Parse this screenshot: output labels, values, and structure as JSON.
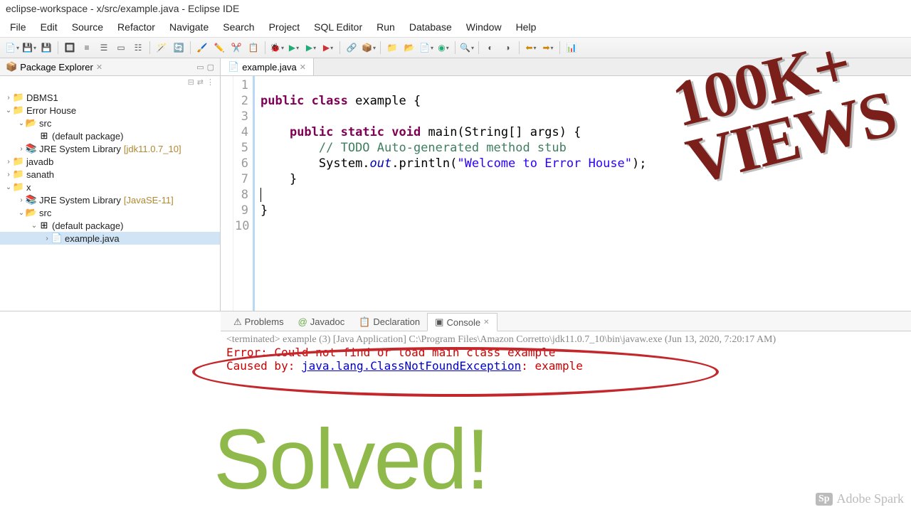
{
  "title": "eclipse-workspace - x/src/example.java - Eclipse IDE",
  "menu": [
    "File",
    "Edit",
    "Source",
    "Refactor",
    "Navigate",
    "Search",
    "Project",
    "SQL Editor",
    "Run",
    "Database",
    "Window",
    "Help"
  ],
  "sidebar": {
    "title": "Package Explorer",
    "items": [
      {
        "indent": 0,
        "tw": "›",
        "icon": "📁",
        "label": "DBMS1"
      },
      {
        "indent": 0,
        "tw": "⌄",
        "icon": "📁",
        "label": "Error House"
      },
      {
        "indent": 1,
        "tw": "⌄",
        "icon": "📂",
        "label": "src"
      },
      {
        "indent": 2,
        "tw": "",
        "icon": "⊞",
        "label": "(default package)"
      },
      {
        "indent": 1,
        "tw": "›",
        "icon": "📚",
        "label": "JRE System Library",
        "meta": "[jdk11.0.7_10]"
      },
      {
        "indent": 0,
        "tw": "›",
        "icon": "📁",
        "label": "javadb"
      },
      {
        "indent": 0,
        "tw": "›",
        "icon": "📁",
        "label": "sanath"
      },
      {
        "indent": 0,
        "tw": "⌄",
        "icon": "📁",
        "label": "x"
      },
      {
        "indent": 1,
        "tw": "›",
        "icon": "📚",
        "label": "JRE System Library",
        "meta": "[JavaSE-11]"
      },
      {
        "indent": 1,
        "tw": "⌄",
        "icon": "📂",
        "label": "src"
      },
      {
        "indent": 2,
        "tw": "⌄",
        "icon": "⊞",
        "label": "(default package)"
      },
      {
        "indent": 3,
        "tw": "›",
        "icon": "📄",
        "label": "example.java",
        "selected": true
      }
    ]
  },
  "editor": {
    "tab": "example.java",
    "lines": [
      "1",
      "2",
      "3",
      "4",
      "5",
      "6",
      "7",
      "8",
      "9",
      "10"
    ]
  },
  "code": {
    "l2a": "public",
    "l2b": "class",
    "l2c": " example {",
    "l4a": "public",
    "l4b": "static",
    "l4c": "void",
    "l4d": " main(String[] args) {",
    "l5a": "// TODO Auto-generated method stub",
    "l6a": "System.",
    "l6b": "out",
    "l6c": ".println(",
    "l6d": "\"Welcome to Error House\"",
    "l6e": ");",
    "l7": "}",
    "l8": "",
    "l9": "}"
  },
  "bottom": {
    "tabs": [
      "Problems",
      "Javadoc",
      "Declaration",
      "Console"
    ],
    "meta": "<terminated> example (3) [Java Application] C:\\Program Files\\Amazon Corretto\\jdk11.0.7_10\\bin\\javaw.exe (Jun 13, 2020, 7:20:17 AM)",
    "err1": "Error: Could not find or load main class example",
    "err2a": "Caused by: ",
    "err2link": "java.lang.ClassNotFoundException",
    "err2b": ": example"
  },
  "overlay": {
    "views1": "100K+",
    "views2": "VIEWS",
    "solved": "Solved!",
    "watermark": "Adobe Spark",
    "sp": "Sp"
  }
}
